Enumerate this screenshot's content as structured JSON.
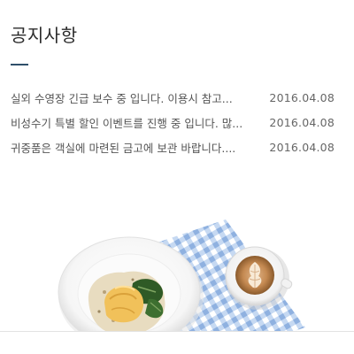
{
  "section": {
    "title": "공지사항"
  },
  "notices": [
    {
      "text": "실외 수영장 긴급 보수 중 입니다. 이용시 참고...",
      "date": "2016.04.08"
    },
    {
      "text": "비성수기 특별 할인 이벤트를 진행 중 입니다. 많...",
      "date": "2016.04.08"
    },
    {
      "text": "귀중품은 객실에 마련된 금고에 보관 바랍니다....",
      "date": "2016.04.08"
    }
  ],
  "image": {
    "icon": "food-plate-with-latte-photo",
    "colors": {
      "napkin": "#a9c4e8",
      "plate": "#ffffff",
      "coffee": "#c58a52"
    }
  }
}
